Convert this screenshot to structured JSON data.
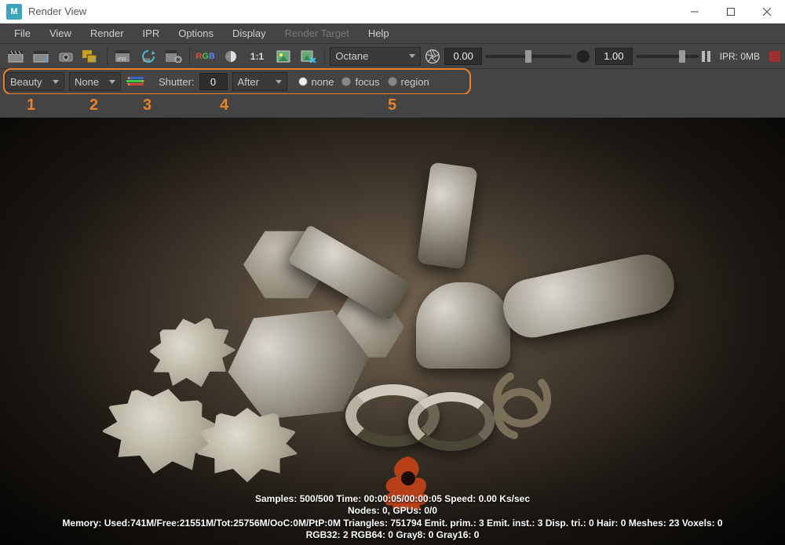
{
  "window": {
    "title": "Render View"
  },
  "window_buttons": {
    "min": "min",
    "max": "max",
    "close": "close"
  },
  "menubar": {
    "file": "File",
    "view": "View",
    "render": "Render",
    "ipr": "IPR",
    "options": "Options",
    "display": "Display",
    "render_target": "Render Target",
    "help": "Help"
  },
  "toolbar1": {
    "ratio": "1:1",
    "renderer_selected": "Octane",
    "exposure_value": "0.00",
    "gamma_value": "1.00",
    "ipr_status": "IPR: 0MB"
  },
  "toolbar2": {
    "pass_selected": "Beauty",
    "layer_selected": "None",
    "shutter_label": "Shutter:",
    "shutter_value": "0",
    "shutter_timing": "After",
    "radios": {
      "none": "none",
      "focus": "focus",
      "region": "region"
    },
    "selected_radio": "none"
  },
  "annotations": {
    "a1": "1",
    "a2": "2",
    "a3": "3",
    "a4": "4",
    "a5": "5"
  },
  "stats": {
    "line1": "Samples: 500/500 Time: 00:00:05/00:00:05 Speed: 0.00 Ks/sec",
    "line2": "Nodes: 0, GPUs: 0/0",
    "line3": "Memory: Used:741M/Free:21551M/Tot:25756M/OoC:0M/PtP:0M Triangles: 751794 Emit. prim.: 3 Emit. inst.: 3 Disp. tri.: 0 Hair: 0 Meshes: 23 Voxels: 0",
    "line4": "RGB32: 2 RGB64: 0 Gray8: 0 Gray16: 0"
  },
  "icons": {
    "clapper": "clapper-icon",
    "clapper_s": "clapper-frame-icon",
    "camera": "snapshot-icon",
    "ipr_s": "ipr-start-icon",
    "ipr_frame": "ipr-frame-icon",
    "ipr_refresh": "ipr-refresh-icon",
    "ipr_options": "ipr-options-icon",
    "rgb": "rgb-channel-icon",
    "contrast": "contrast-icon",
    "image1": "display-image-icon",
    "image_x": "remove-image-icon",
    "aperture": "aperture-icon",
    "halfmoon": "exposure-icon",
    "pause": "pause-icon",
    "record": "record-icon",
    "colorbar": "lut-colorbar-icon"
  }
}
